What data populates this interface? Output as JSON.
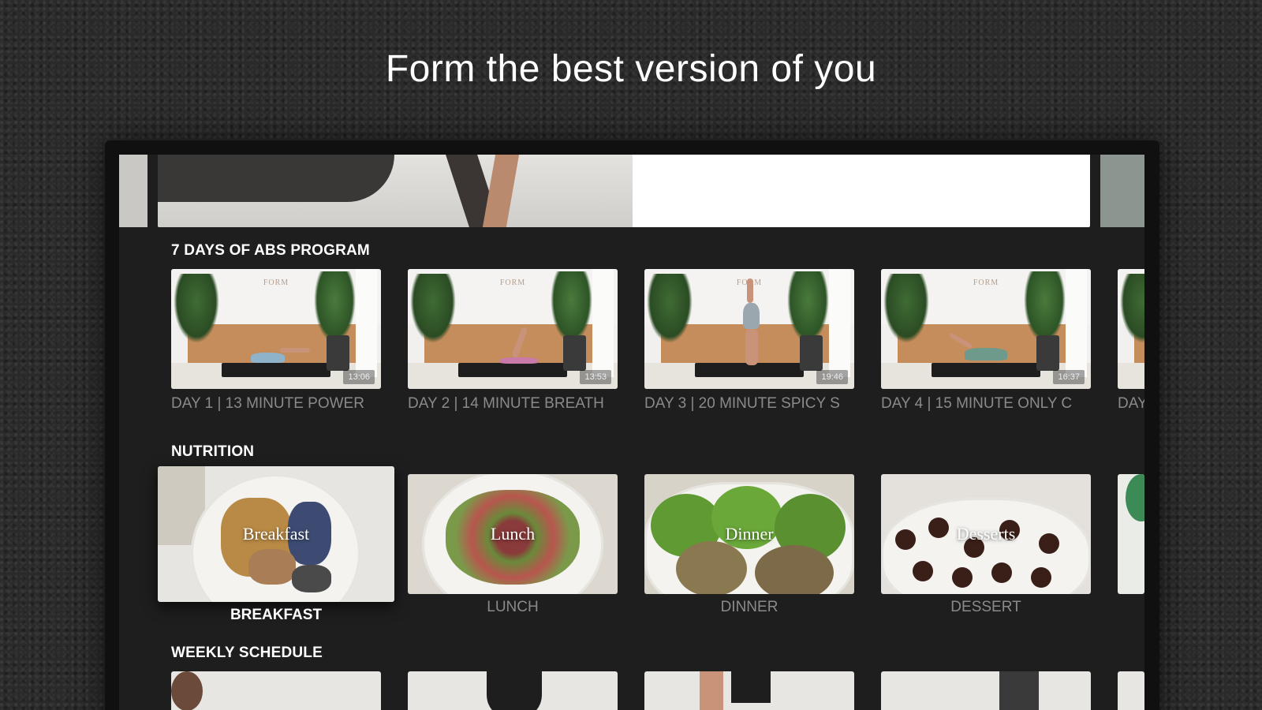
{
  "headline": "Form the best version of you",
  "sections": {
    "abs": {
      "title": "7 DAYS OF ABS PROGRAM",
      "items": [
        {
          "label": "DAY 1 | 13 MINUTE POWER",
          "duration": "13:06"
        },
        {
          "label": "DAY 2 | 14 MINUTE BREATH",
          "duration": "13:53"
        },
        {
          "label": "DAY 3 | 20 MINUTE SPICY S",
          "duration": "19:46"
        },
        {
          "label": "DAY 4 | 15 MINUTE ONLY C",
          "duration": "16:37"
        },
        {
          "label": "DAY",
          "duration": ""
        }
      ]
    },
    "nutrition": {
      "title": "NUTRITION",
      "items": [
        {
          "title": "Breakfast",
          "label": "BREAKFAST",
          "focused": true
        },
        {
          "title": "Lunch",
          "label": "LUNCH",
          "focused": false
        },
        {
          "title": "Dinner",
          "label": "DINNER",
          "focused": false
        },
        {
          "title": "Desserts",
          "label": "DESSERT",
          "focused": false
        }
      ]
    },
    "schedule": {
      "title": "WEEKLY SCHEDULE"
    }
  },
  "colors": {
    "background": "#2a2a2a",
    "screen": "#1e1e1e",
    "label_dim": "#8a8a8a",
    "label_focus": "#ffffff"
  }
}
